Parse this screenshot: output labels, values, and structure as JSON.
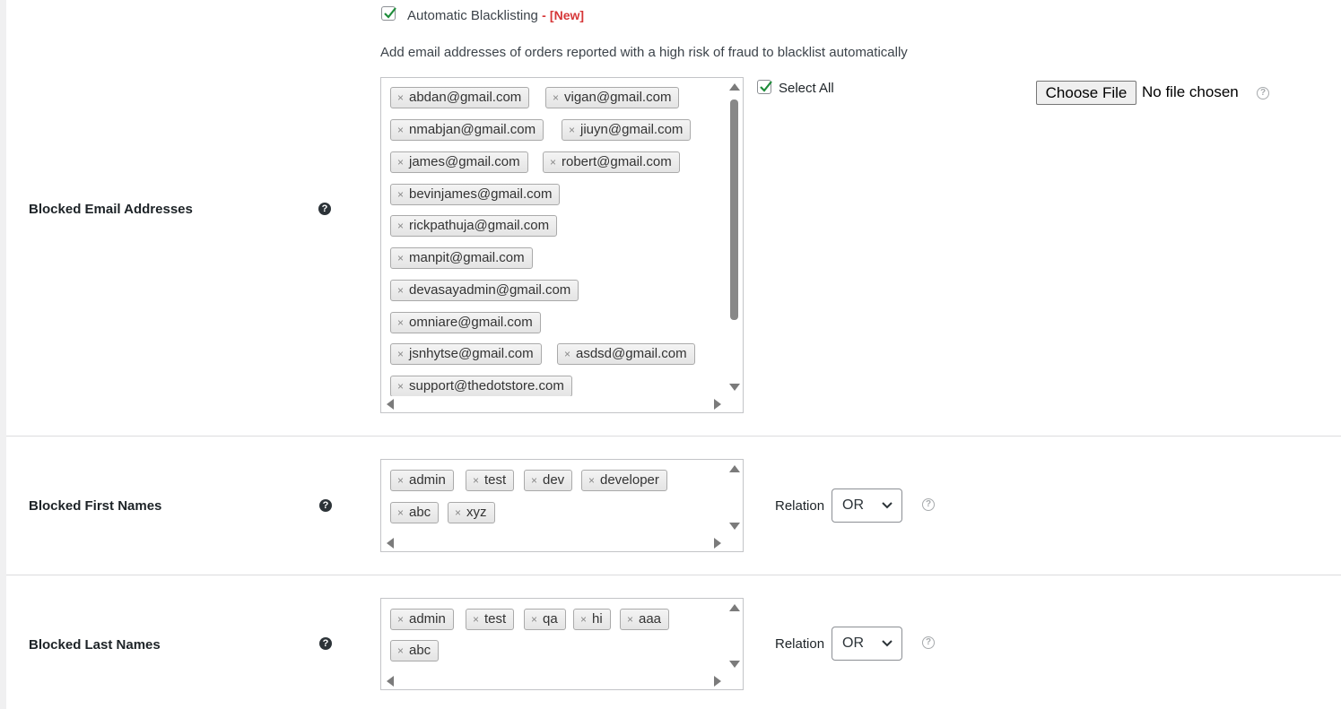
{
  "auto_blacklist": {
    "checked": true,
    "label": "Automatic Blacklisting",
    "dash": "-",
    "new_badge": "[New]",
    "description": "Add email addresses of orders reported with a high risk of fraud to blacklist automatically"
  },
  "emails": {
    "label": "Blocked Email Addresses",
    "help_icon": "question-circle-icon",
    "items": [
      "abdan@gmail.com",
      "vigan@gmail.com",
      "nmabjan@gmail.com",
      "jiuyn@gmail.com",
      "james@gmail.com",
      "robert@gmail.com",
      "bevinjames@gmail.com",
      "rickpathuja@gmail.com",
      "manpit@gmail.com",
      "devasayadmin@gmail.com",
      "omniare@gmail.com",
      "jsnhytse@gmail.com",
      "asdsd@gmail.com",
      "support@thedotstore.com"
    ],
    "remove_glyph": "×",
    "select_all_label": "Select All",
    "select_all_checked": true,
    "file_button_label": "Choose File",
    "file_status": "No file chosen"
  },
  "first_names": {
    "label": "Blocked First Names",
    "items": [
      "admin",
      "test",
      "dev",
      "developer",
      "abc",
      "xyz"
    ],
    "relation_label": "Relation",
    "relation_value": "OR"
  },
  "last_names": {
    "label": "Blocked Last Names",
    "items": [
      "admin",
      "test",
      "qa",
      "hi",
      "aaa",
      "abc"
    ],
    "relation_label": "Relation",
    "relation_value": "OR"
  },
  "colors": {
    "new_badge": "#d63638",
    "check_mark": "#1e8c3a",
    "divider": "#dcdcde"
  }
}
